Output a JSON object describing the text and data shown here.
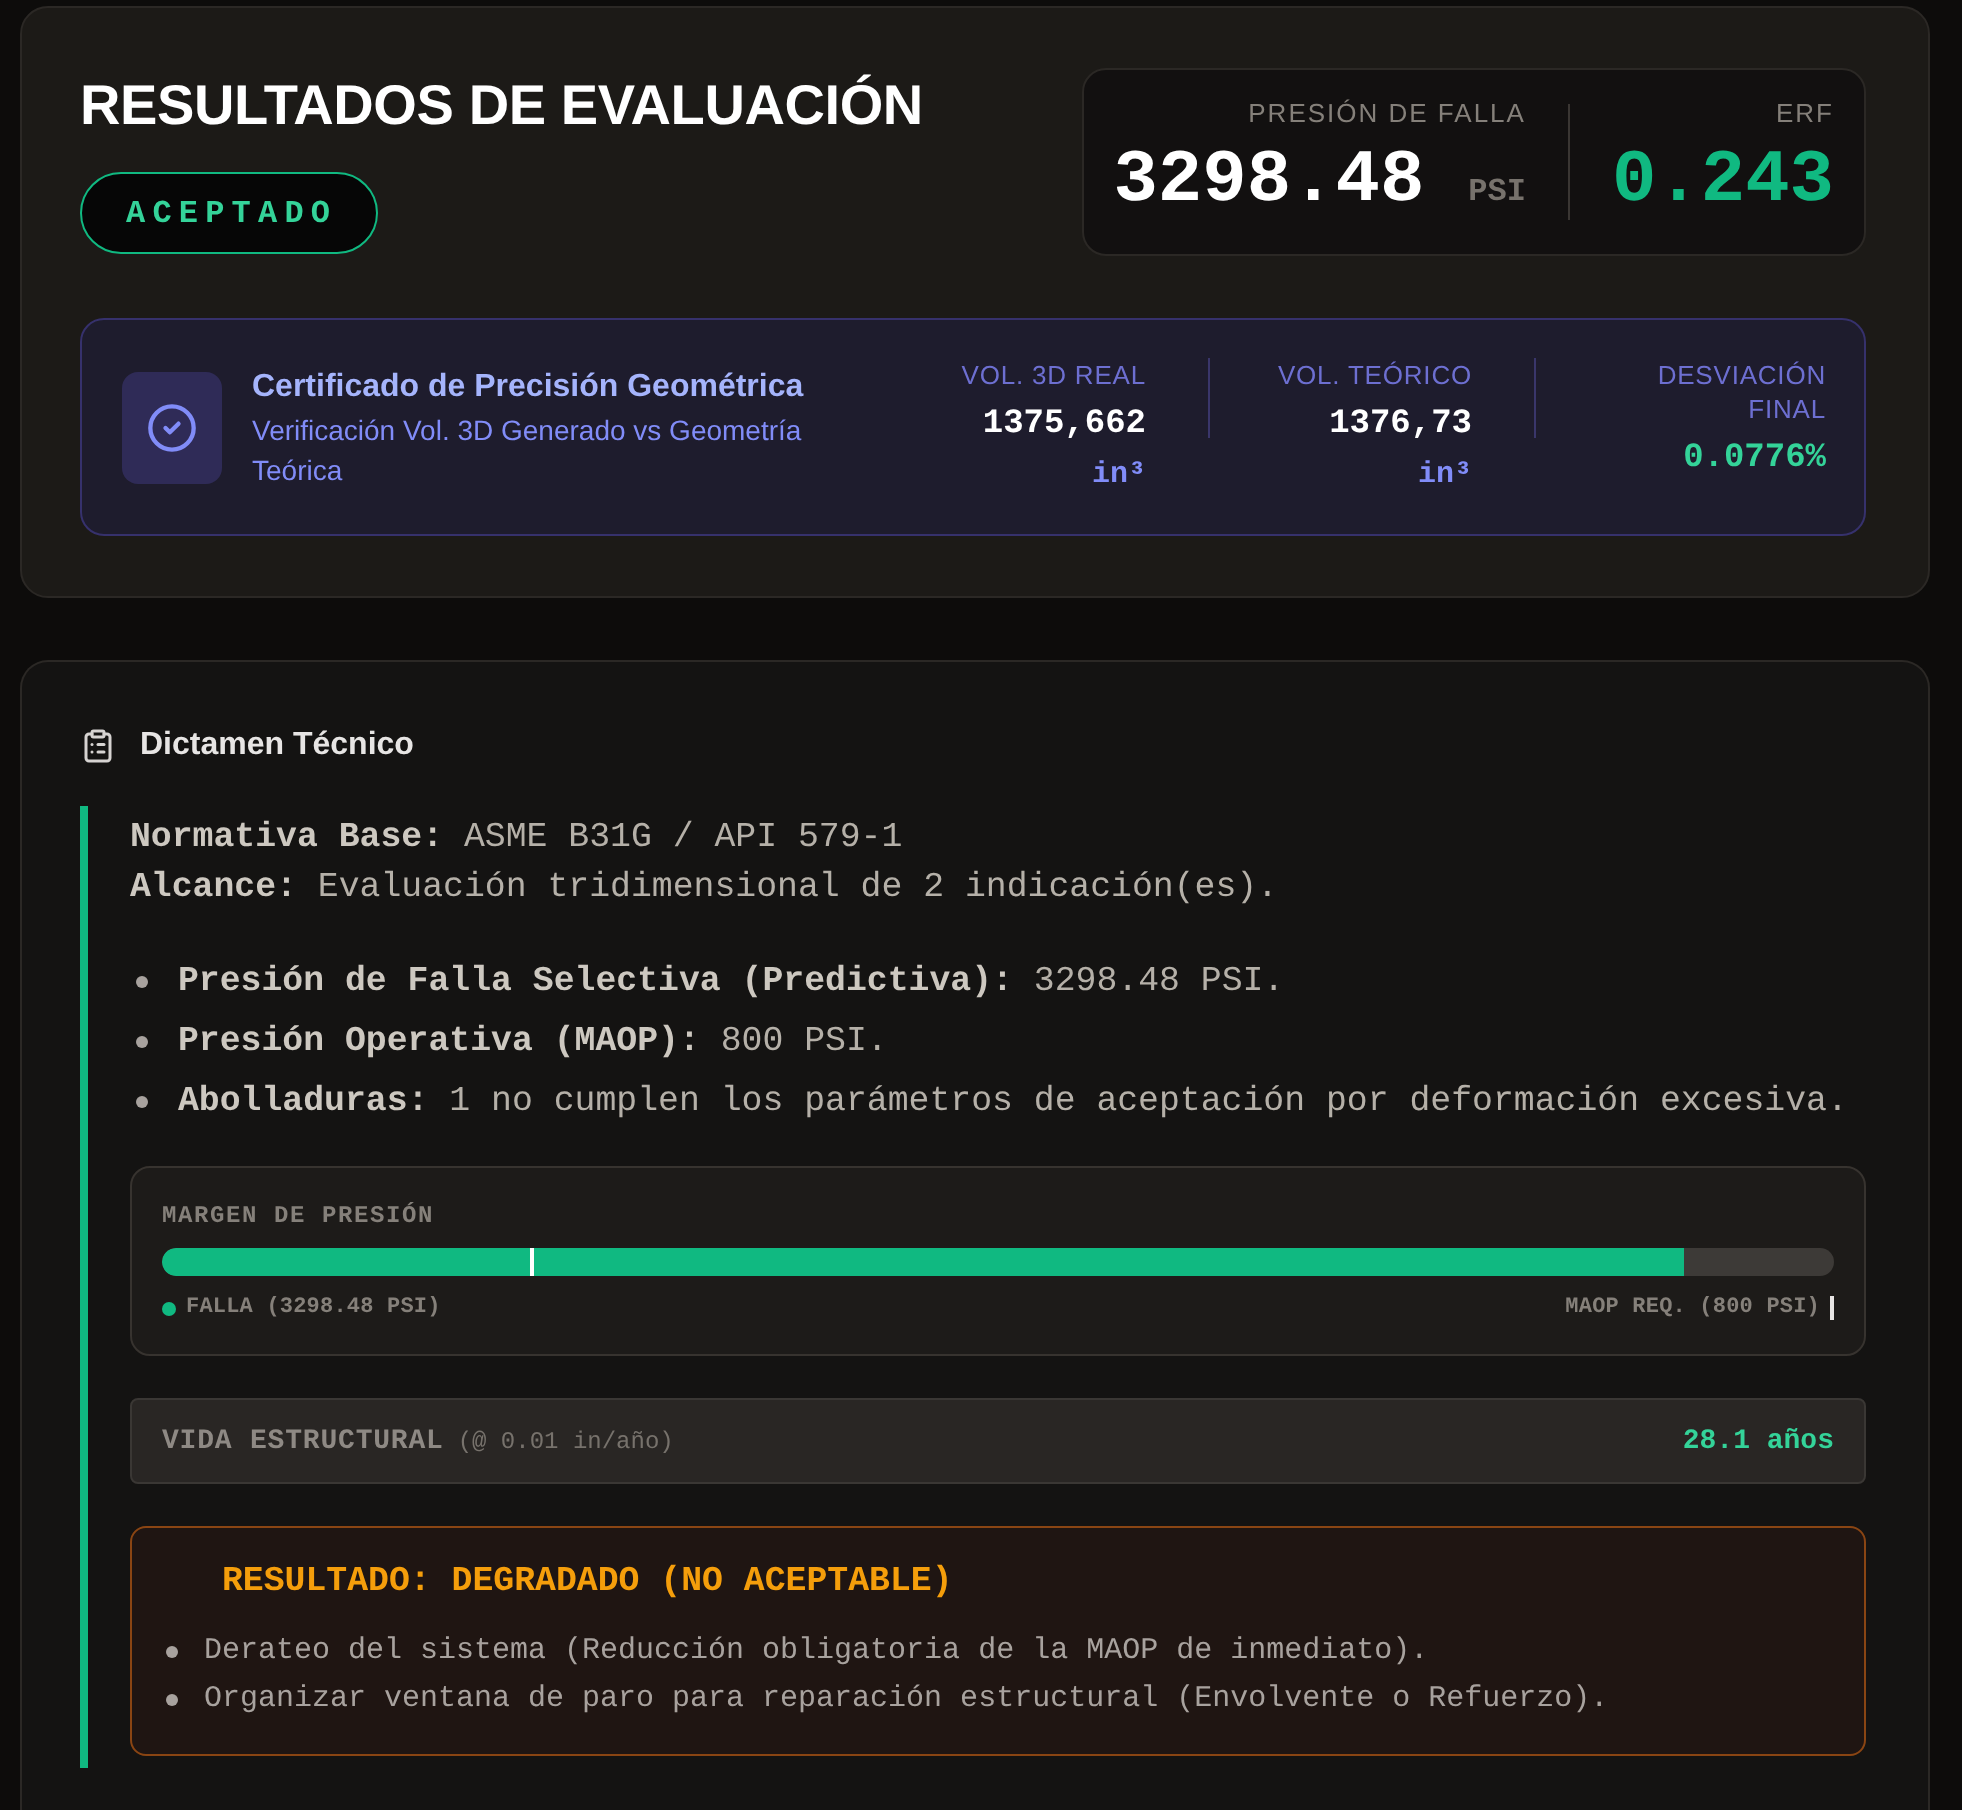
{
  "header": {
    "title": "RESULTADOS DE EVALUACIÓN",
    "status_badge": {
      "label": "ACEPTADO",
      "kind": "accepted"
    }
  },
  "stats": [
    {
      "label": "PRESIÓN DE FALLA",
      "value": "3298.48",
      "unit": "PSI",
      "kind": "neutral"
    },
    {
      "label": "ERF",
      "value": "0.243",
      "kind": "positive"
    }
  ],
  "certificate": {
    "title": "Certificado de Precisión Geométrica",
    "subtitle": "Verificación Vol. 3D Generado vs Geometría Teórica",
    "metrics": [
      {
        "label": "VOL. 3D REAL",
        "value": "1375,662",
        "unit": "in³",
        "kind": "volume"
      },
      {
        "label": "VOL. TEÓRICO",
        "value": "1376,73",
        "unit": "in³",
        "kind": "volume"
      },
      {
        "label": "DESVIACIÓN FINAL",
        "value": "0.0776%",
        "kind": "deviation"
      }
    ]
  },
  "report": {
    "title": "Dictamen Técnico",
    "summary": [
      "**Normativa Base:** ASME B31G / API 579-1",
      "**Alcance:** Evaluación tridimensional de 2 indicación(es)."
    ],
    "findings": [
      "**Presión de Falla Selectiva (Predictiva):** 3298.48 PSI.",
      "**Presión Operativa (MAOP):** 800 PSI.",
      "**Abolladuras:** 1 no cumplen los parámetros de aceptación por deformación excesiva."
    ],
    "pressure_margin": {
      "label": "MARGEN DE PRESIÓN",
      "level": 0.91,
      "maop_marker": {
        "level": 0.22
      },
      "failure_legend": "FALLA (3298.48 PSI)",
      "maop_legend": "MAOP REQ. (800 PSI)"
    },
    "structural_life": {
      "label": "VIDA ESTRUCTURAL",
      "note": "(@ 0.01 in/año)",
      "value": "28.1 años"
    },
    "result": {
      "title": "RESULTADO: DEGRADADO (NO ACEPTABLE)",
      "kind": "degraded",
      "actions": [
        "Derateo del sistema (Reducción obligatoria de la MAOP de inmediato).",
        "Organizar ventana de paro para reparación estructural (Envolvente o Refuerzo)."
      ]
    }
  }
}
